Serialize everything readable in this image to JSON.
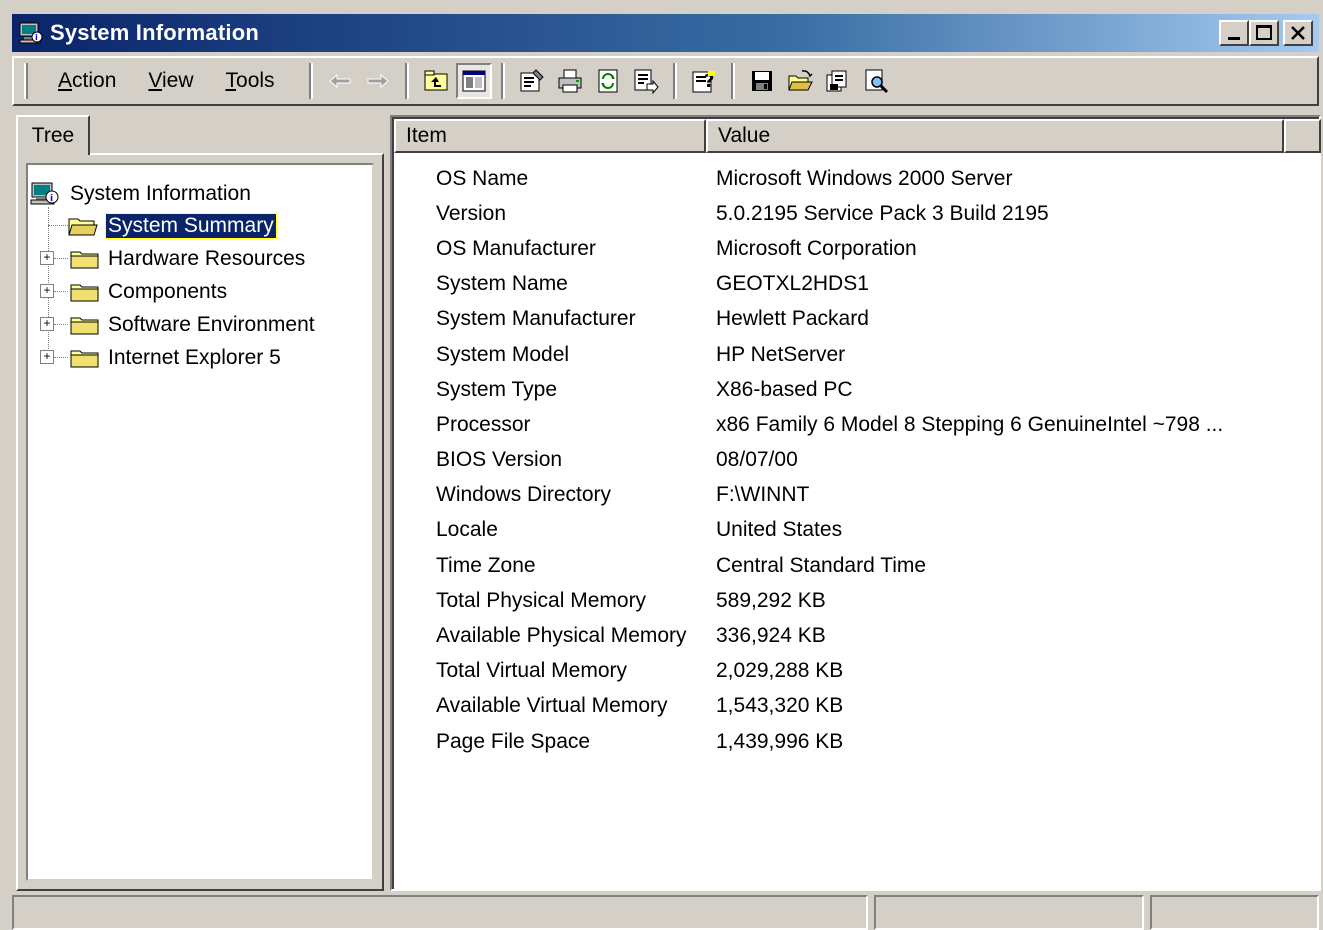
{
  "window": {
    "title": "System Information",
    "icon": "system-info-icon"
  },
  "menu": {
    "action": {
      "accel": "A",
      "rest": "ction"
    },
    "view": {
      "accel": "V",
      "rest": "iew"
    },
    "tools": {
      "accel": "T",
      "rest": "ools"
    }
  },
  "toolbar_icons": [
    "back-arrow-icon",
    "forward-arrow-icon",
    "up-folder-icon",
    "show-hide-tree-icon",
    "properties-icon",
    "print-icon",
    "refresh-icon",
    "export-list-icon",
    "help-icon",
    "save-icon",
    "open-icon",
    "find-icon",
    "system-info-view-icon"
  ],
  "tree": {
    "tab_label": "Tree",
    "root": "System Information",
    "items": [
      {
        "label": "System Summary",
        "selected": true,
        "expandable": false
      },
      {
        "label": "Hardware Resources",
        "selected": false,
        "expandable": true
      },
      {
        "label": "Components",
        "selected": false,
        "expandable": true
      },
      {
        "label": "Software Environment",
        "selected": false,
        "expandable": true
      },
      {
        "label": "Internet Explorer 5",
        "selected": false,
        "expandable": true
      }
    ]
  },
  "list": {
    "columns": [
      "Item",
      "Value"
    ],
    "rows": [
      [
        "OS Name",
        "Microsoft Windows 2000 Server"
      ],
      [
        "Version",
        "5.0.2195 Service Pack 3 Build 2195"
      ],
      [
        "OS Manufacturer",
        "Microsoft Corporation"
      ],
      [
        "System Name",
        "GEOTXL2HDS1"
      ],
      [
        "System Manufacturer",
        "Hewlett Packard"
      ],
      [
        "System Model",
        "HP NetServer"
      ],
      [
        "System Type",
        "X86-based PC"
      ],
      [
        "Processor",
        "x86 Family 6 Model 8 Stepping 6 GenuineIntel ~798 ..."
      ],
      [
        "BIOS Version",
        "08/07/00"
      ],
      [
        "Windows Directory",
        "F:\\WINNT"
      ],
      [
        "Locale",
        "United States"
      ],
      [
        "Time Zone",
        "Central Standard Time"
      ],
      [
        "Total Physical Memory",
        "589,292 KB"
      ],
      [
        "Available Physical Memory",
        "336,924 KB"
      ],
      [
        "Total Virtual Memory",
        "2,029,288 KB"
      ],
      [
        "Available Virtual Memory",
        "1,543,320 KB"
      ],
      [
        "Page File Space",
        "1,439,996 KB"
      ]
    ]
  },
  "colors": {
    "title_gradient_start": "#0a246a",
    "title_gradient_end": "#a6caf0",
    "face": "#d4d0c8",
    "selection": "#0a246a"
  }
}
